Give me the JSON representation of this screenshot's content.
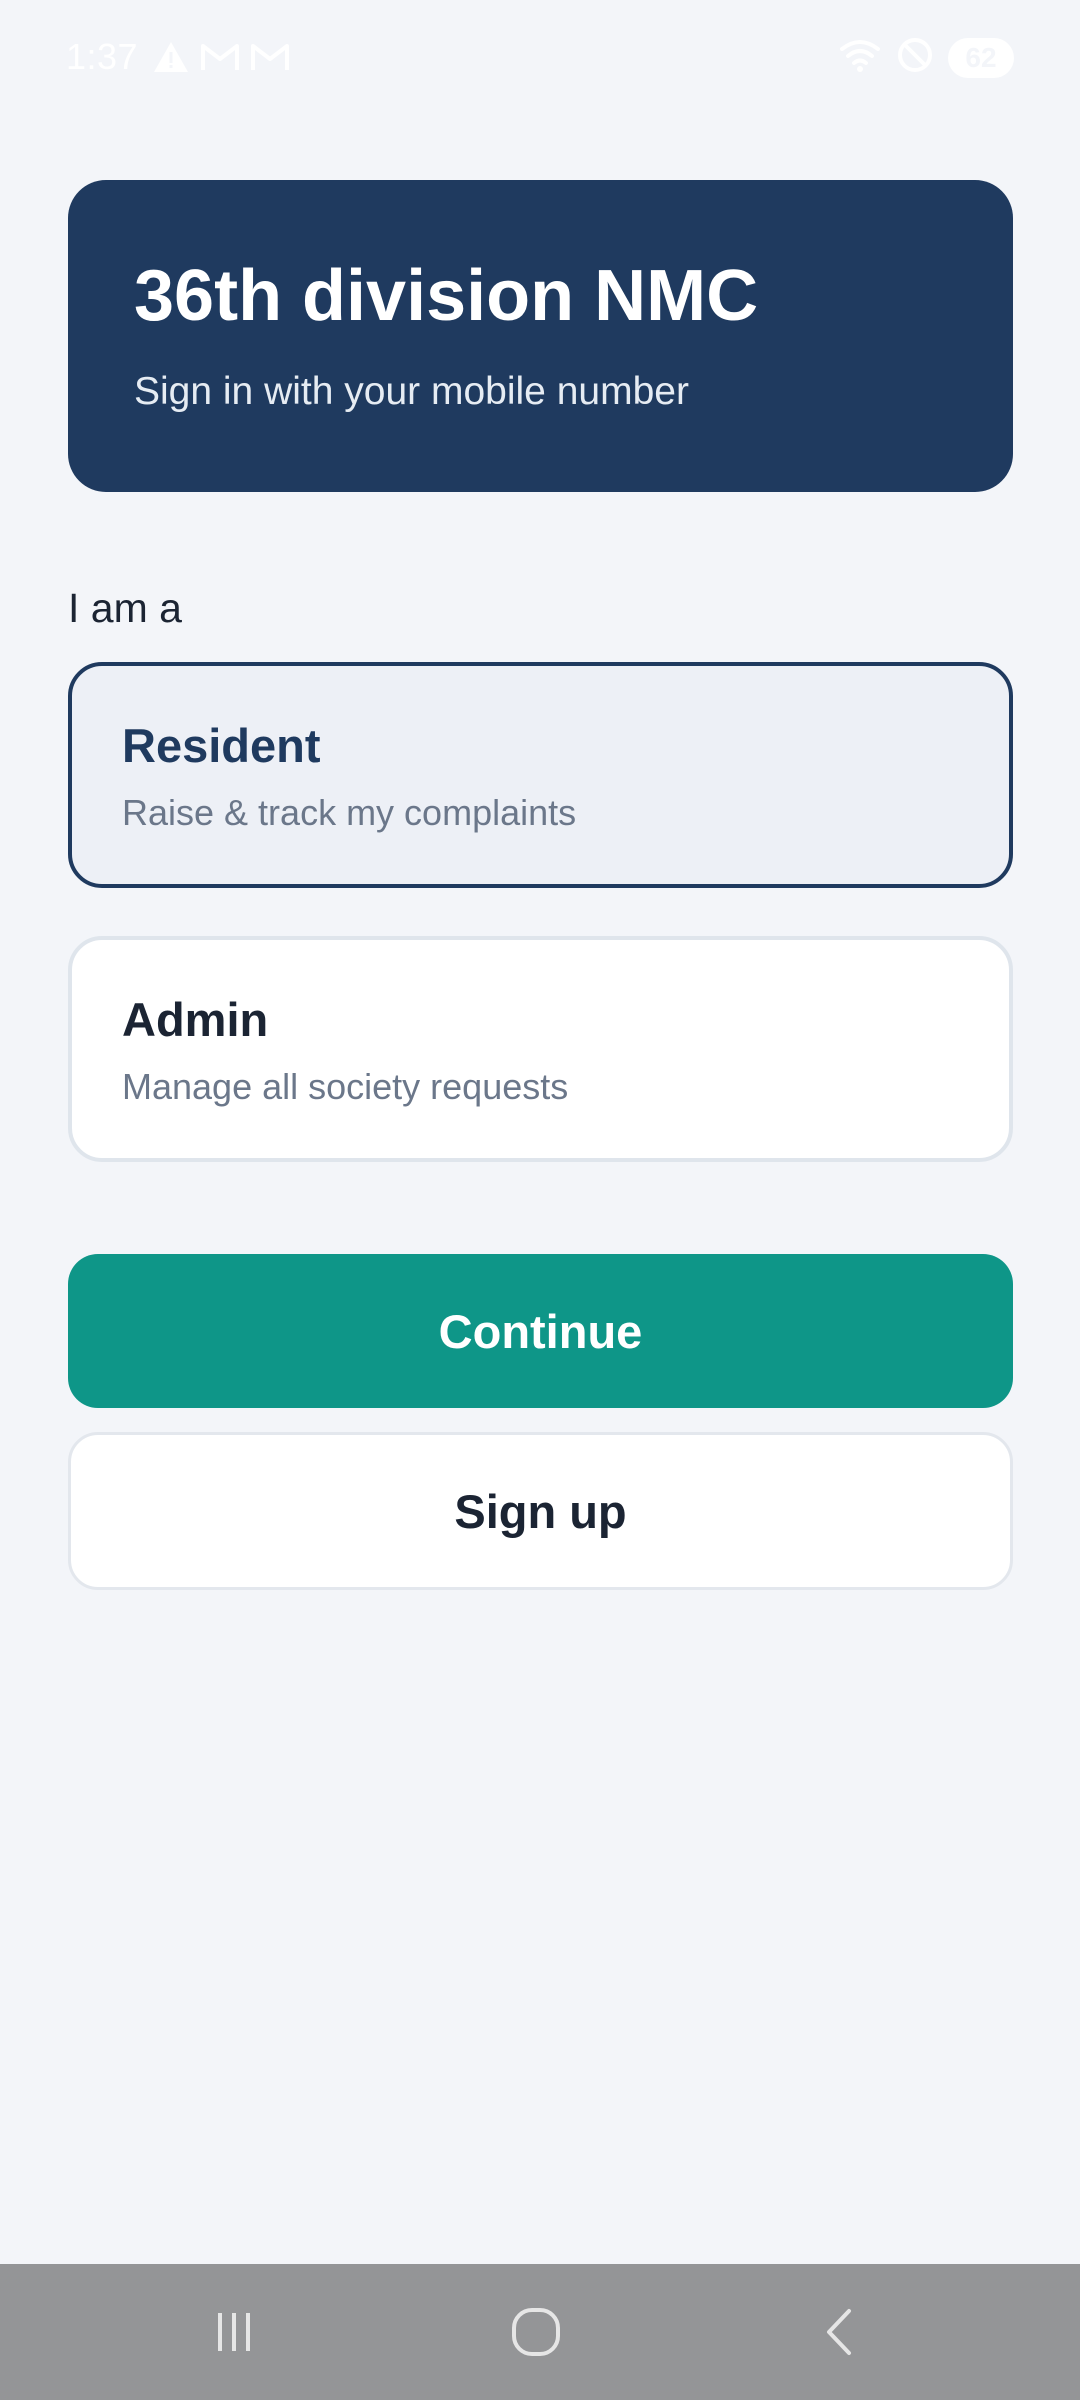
{
  "status_bar": {
    "time": "1:37",
    "battery": "62",
    "left_icons": [
      "warning-icon",
      "gmail-icon",
      "gmail-icon"
    ],
    "right_icons": [
      "wifi-icon",
      "do-not-disturb-icon",
      "battery-icon"
    ]
  },
  "header": {
    "title": "36th division NMC",
    "subtitle": "Sign in with your mobile number",
    "color": "#1f3a5f"
  },
  "role_section": {
    "label": "I am a",
    "options": [
      {
        "title": "Resident",
        "description": "Raise & track my complaints",
        "selected": true
      },
      {
        "title": "Admin",
        "description": "Manage all society requests",
        "selected": false
      }
    ]
  },
  "actions": {
    "continue_label": "Continue",
    "signup_label": "Sign up",
    "accent_color": "#0e9688"
  },
  "nav_bar": {
    "buttons": [
      "recent-apps-icon",
      "home-icon",
      "back-icon"
    ]
  }
}
